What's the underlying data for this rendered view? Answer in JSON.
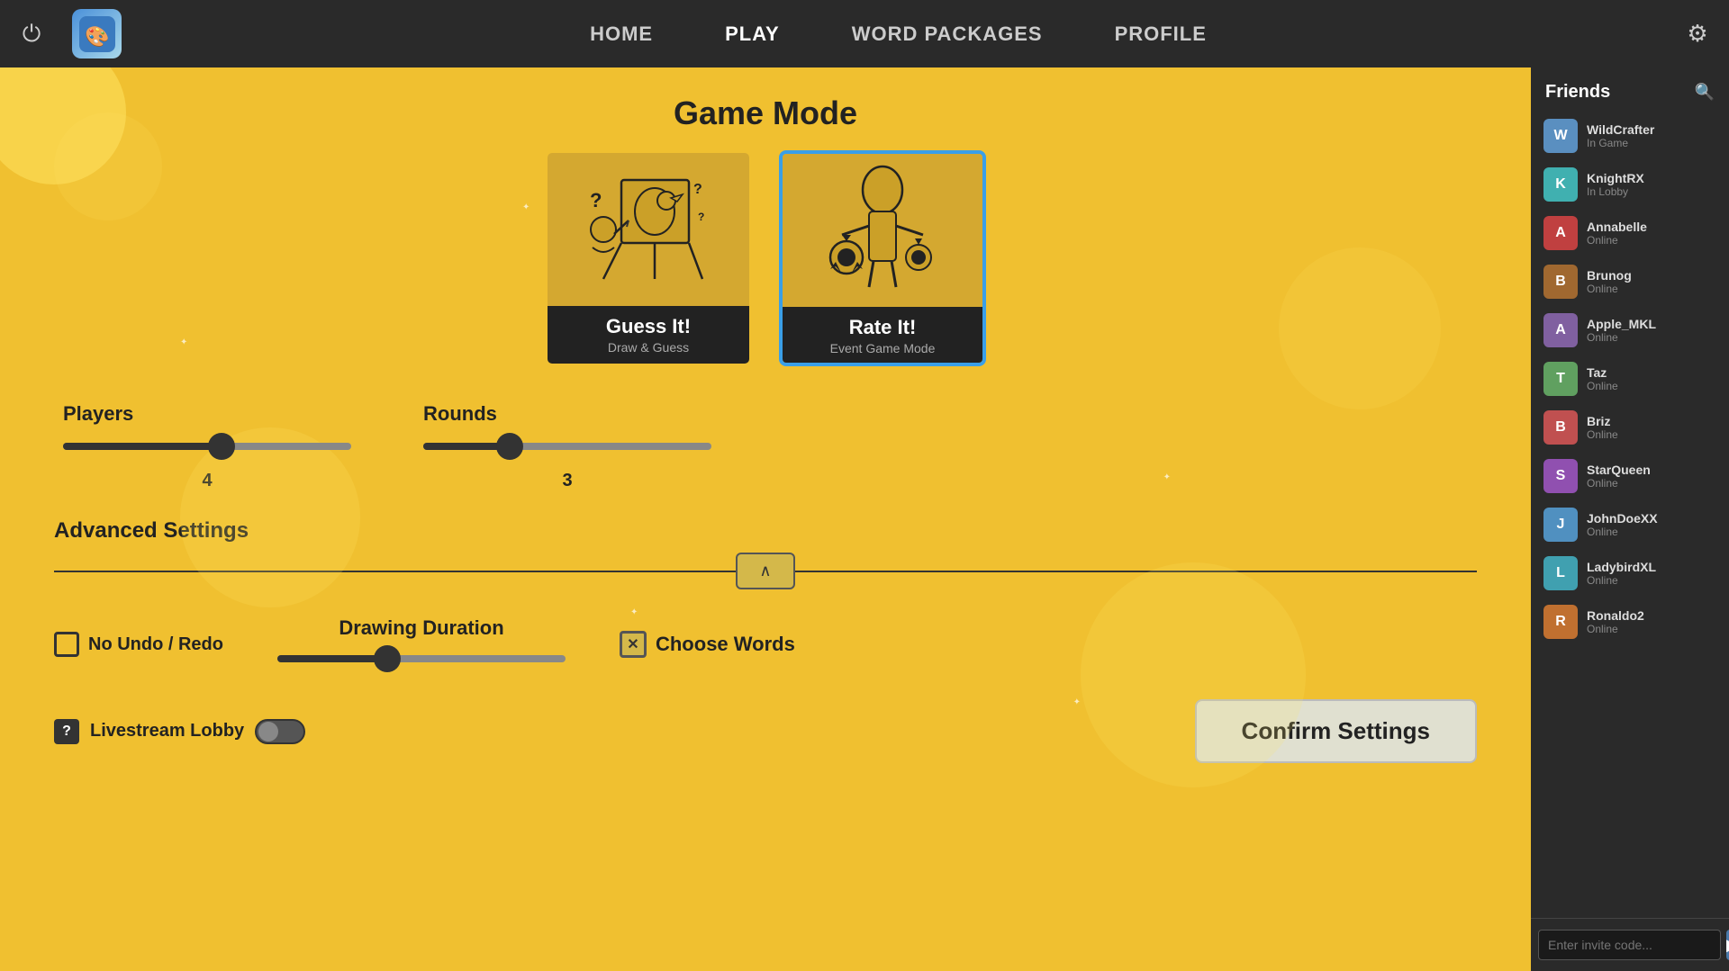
{
  "nav": {
    "home_label": "HOME",
    "play_label": "PLAY",
    "word_packages_label": "WORD PACKAGES",
    "profile_label": "PROFILE"
  },
  "game_mode": {
    "title": "Game Mode",
    "cards": [
      {
        "id": "guess-it",
        "title": "Guess It!",
        "subtitle": "Draw & Guess",
        "selected": false
      },
      {
        "id": "rate-it",
        "title": "Rate It!",
        "subtitle": "Event Game Mode",
        "selected": true
      }
    ]
  },
  "sliders": {
    "players_label": "Players",
    "players_value": "4",
    "rounds_label": "Rounds",
    "rounds_value": "3"
  },
  "advanced_settings": {
    "title": "Advanced Settings",
    "toggle_icon": "∧"
  },
  "bottom_settings": {
    "no_undo_label": "No Undo / Redo",
    "drawing_duration_label": "Drawing Duration",
    "choose_words_label": "Choose Words"
  },
  "footer": {
    "livestream_label": "Livestream Lobby",
    "confirm_label": "Confirm Settings",
    "invite_placeholder": "Enter invite code..."
  },
  "sidebar": {
    "title": "Friends",
    "friends": [
      {
        "name": "WildCrafter",
        "status": "In Game",
        "color": "#5a8fc0"
      },
      {
        "name": "KnightRX",
        "status": "In Lobby",
        "color": "#40b0b0"
      },
      {
        "name": "Annabelle",
        "status": "Online",
        "color": "#c04040"
      },
      {
        "name": "Brunog",
        "status": "Online",
        "color": "#a06830"
      },
      {
        "name": "Apple_MKL",
        "status": "Online",
        "color": "#8060a0"
      },
      {
        "name": "Taz",
        "status": "Online",
        "color": "#60a060"
      },
      {
        "name": "Briz",
        "status": "Online",
        "color": "#c05050"
      },
      {
        "name": "StarQueen",
        "status": "Online",
        "color": "#9050b0"
      },
      {
        "name": "JohnDoeXX",
        "status": "Online",
        "color": "#5090c0"
      },
      {
        "name": "LadybirdXL",
        "status": "Online",
        "color": "#40a0b0"
      },
      {
        "name": "Ronaldo2",
        "status": "Online",
        "color": "#c07030"
      }
    ]
  }
}
